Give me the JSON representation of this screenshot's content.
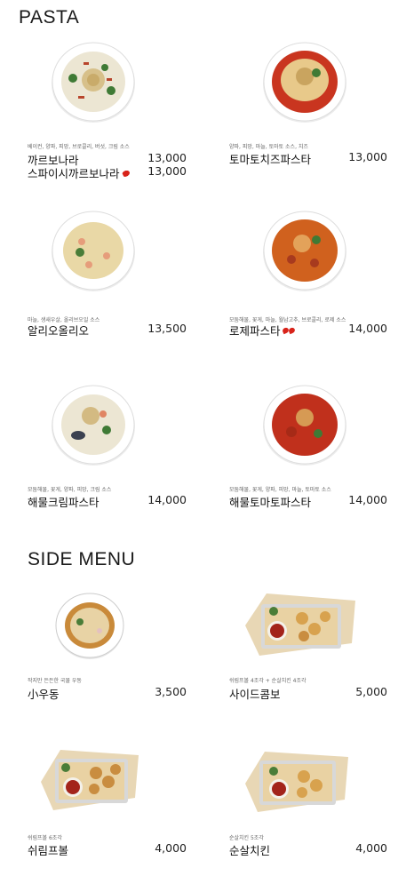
{
  "sections": {
    "pasta_title": "PASTA",
    "side_title": "SIDE MENU"
  },
  "pasta": [
    {
      "ingredients": "베이컨, 양파, 피망, 브로콜리, 버섯, 크림 소스",
      "name": "까르보나라",
      "price": "13,000",
      "name2": "스파이시까르보나라",
      "price2": "13,000"
    },
    {
      "ingredients": "양파, 피망, 마늘, 토마토 소스, 치즈",
      "name": "토마토치즈파스타",
      "price": "13,000"
    },
    {
      "ingredients": "마늘, 생새우살, 올리브오일 소스",
      "name": "알리오올리오",
      "price": "13,500"
    },
    {
      "ingredients": "모둠해물, 꽃게, 마늘, 월남고추, 브로콜리, 로제 소스",
      "name": "로제파스타",
      "price": "14,000"
    },
    {
      "ingredients": "모둠해물, 꽃게, 양파, 피망, 크림 소스",
      "name": "해물크림파스타",
      "price": "14,000"
    },
    {
      "ingredients": "모둠해물, 꽃게, 양파, 피망, 마늘, 토마토 소스",
      "name": "해물토마토파스타",
      "price": "14,000"
    }
  ],
  "side": [
    {
      "ingredients": "작지만 든든한 국물 우동",
      "name": "小우동",
      "price": "3,500"
    },
    {
      "ingredients": "쉬림프볼 4조각 + 순살치킨 4조각",
      "name": "사이드콤보",
      "price": "5,000"
    },
    {
      "ingredients": "쉬림프볼 6조각",
      "name": "쉬림프볼",
      "price": "4,000"
    },
    {
      "ingredients": "순살치킨 5조각",
      "name": "순살치킨",
      "price": "4,000"
    }
  ],
  "colors": {
    "cream": "#efe9d8",
    "tomato": "#c9351f",
    "rose": "#d0611e",
    "plate": "#ffffff",
    "tray": "#e8d7b5"
  },
  "icons": {
    "spicy": "chili-pepper-icon"
  }
}
